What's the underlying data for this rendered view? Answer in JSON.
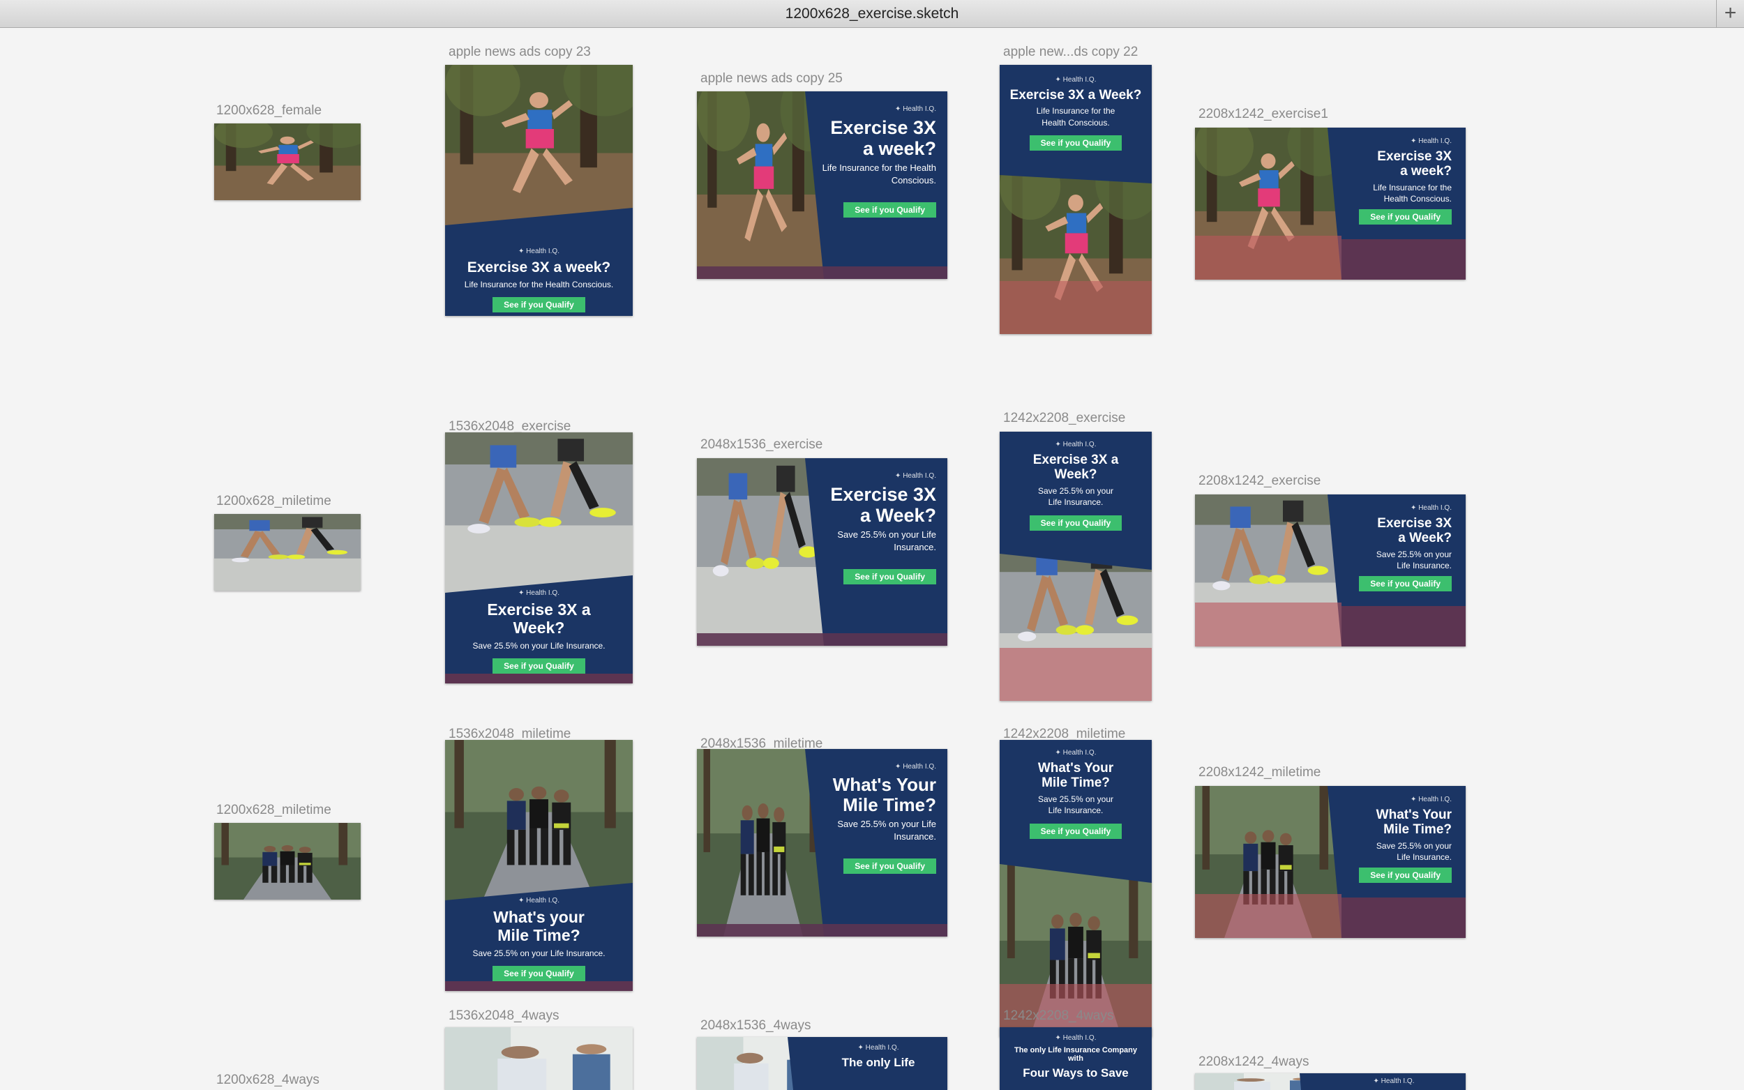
{
  "window": {
    "title": "1200x628_exercise.sketch"
  },
  "labels": {
    "female_1200": "1200x628_female",
    "copy23": "apple news ads copy 23",
    "copy25": "apple news ads copy 25",
    "copy22": "apple new...ds copy 22",
    "exercise1_2208": "2208x1242_exercise1",
    "miletime_1200_a": "1200x628_miletime",
    "exercise_1536": "1536x2048_exercise",
    "exercise_2048": "2048x1536_exercise",
    "exercise_1242": "1242x2208_exercise",
    "exercise_2208": "2208x1242_exercise",
    "miletime_1200_b": "1200x628_miletime",
    "miletime_1536": "1536x2048_miletime",
    "miletime_2048": "2048x1536_miletime",
    "miletime_1242": "1242x2208_miletime",
    "miletime_2208": "2208x1242_miletime",
    "fourways_1200": "1200x628_4ways",
    "fourways_1536": "1536x2048_4ways",
    "fourways_2048": "2048x1536_4ways",
    "fourways_1242": "1242x2208_4ways",
    "fourways_2208": "2208x1242_4ways"
  },
  "ad": {
    "logo": "✦ Health I.Q.",
    "cta": "See if you Qualify",
    "copy23_headline": "Exercise 3X a week?",
    "copy23_sub": "Life Insurance for the Health Conscious.",
    "copy25_headline": "Exercise 3X a week?",
    "copy25_sub": "Life Insurance for the Health Conscious.",
    "copy22_headline": "Exercise 3X a Week?",
    "copy22_sub": "Life Insurance for the Health Conscious.",
    "exercise1_2208_headline": "Exercise 3X a week?",
    "exercise1_2208_sub": "Life Insurance for the Health Conscious.",
    "exercise_1536_headline": "Exercise 3X a Week?",
    "exercise_1536_sub": "Save 25.5% on your Life Insurance.",
    "exercise_2048_headline": "Exercise 3X a Week?",
    "exercise_2048_sub": "Save 25.5% on your Life Insurance.",
    "exercise_1242_headline": "Exercise 3X a Week?",
    "exercise_1242_sub": "Save 25.5% on your Life Insurance.",
    "exercise_2208_headline": "Exercise 3X a Week?",
    "exercise_2208_sub": "Save 25.5% on your Life Insurance.",
    "miletime_1536_headline": "What's your Mile Time?",
    "miletime_1536_sub": "Save 25.5% on your Life Insurance.",
    "miletime_2048_headline": "What's Your Mile Time?",
    "miletime_2048_sub": "Save 25.5% on your Life Insurance.",
    "miletime_1242_headline": "What's Your Mile Time?",
    "miletime_1242_sub": "Save 25.5% on your Life Insurance.",
    "miletime_2208_headline": "What's Your Mile Time?",
    "miletime_2208_sub": "Save 25.5% on your Life Insurance.",
    "fourways_2048_headline": "The only Life",
    "fourways_1242_headline": "The only Life Insurance Company with",
    "fourways_1242_headline2": "Four Ways to Save"
  },
  "colors": {
    "navy": "#1b3564",
    "cta_green": "#3cbf6e",
    "track_red": "#b9555b",
    "accent_plum": "#5c3451"
  },
  "icons": {
    "add_tab": "plus-icon",
    "brand": "health-iq-logo-icon"
  }
}
